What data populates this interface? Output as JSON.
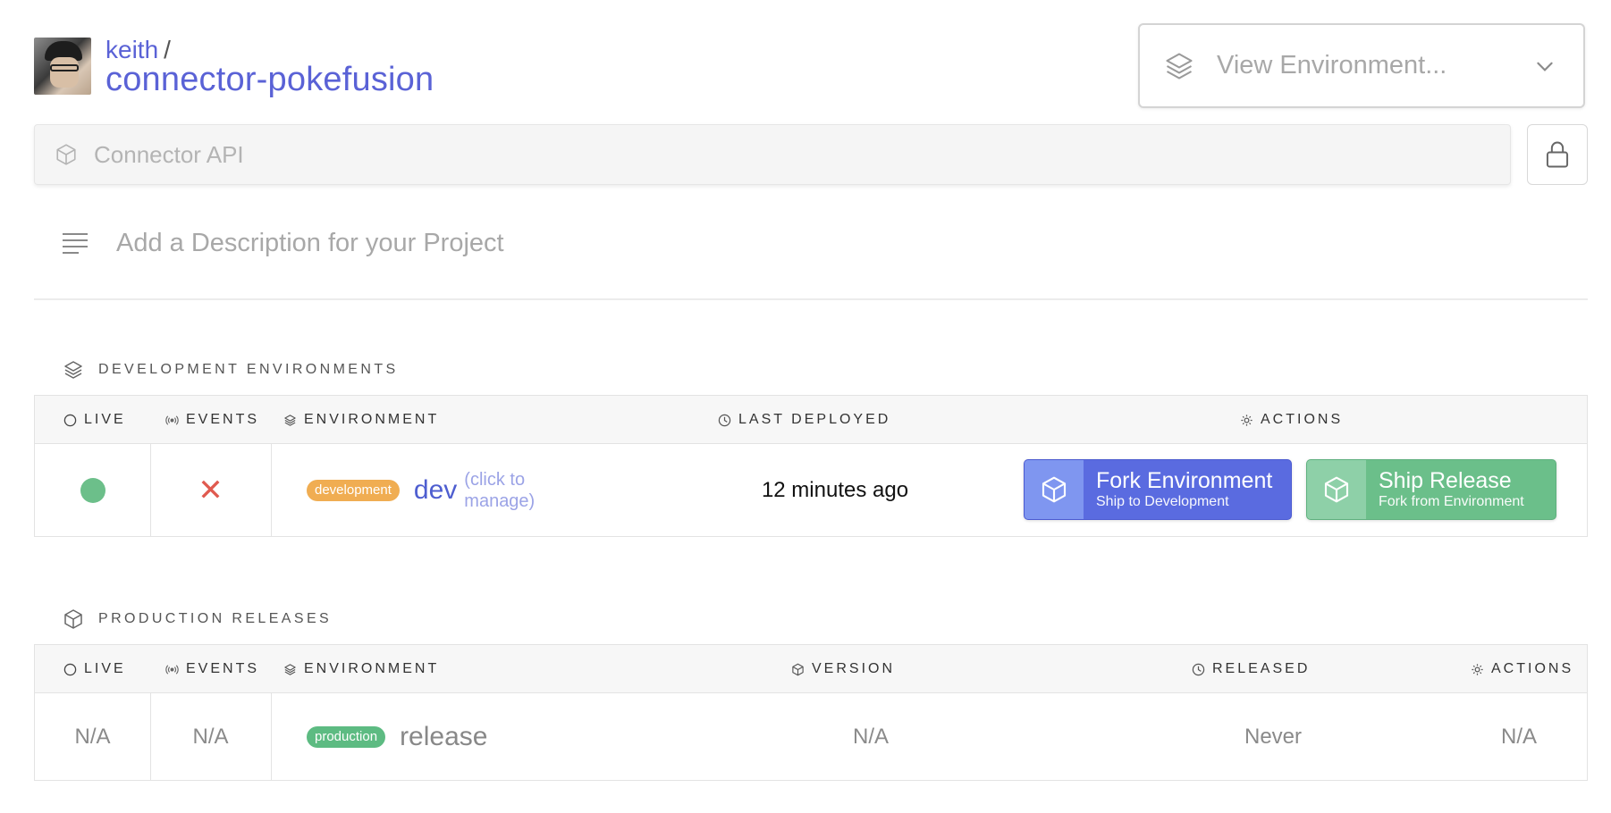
{
  "header": {
    "owner": "keith",
    "separator": "/",
    "project": "connector-pokefusion",
    "env_select_placeholder": "View Environment...",
    "api_placeholder": "Connector API",
    "description_placeholder": "Add a Description for your Project"
  },
  "dev_section": {
    "title": "DEVELOPMENT ENVIRONMENTS",
    "columns": {
      "live": "LIVE",
      "events": "EVENTS",
      "environment": "ENVIRONMENT",
      "last_deployed": "LAST DEPLOYED",
      "actions": "ACTIONS"
    },
    "row": {
      "live": true,
      "events": "✕",
      "badge": "development",
      "env": "dev",
      "hint": "(click to manage)",
      "last_deployed": "12 minutes ago",
      "fork_title": "Fork Environment",
      "fork_sub": "Ship to Development",
      "ship_title": "Ship Release",
      "ship_sub": "Fork from Environment"
    }
  },
  "prod_section": {
    "title": "PRODUCTION RELEASES",
    "columns": {
      "live": "LIVE",
      "events": "EVENTS",
      "environment": "ENVIRONMENT",
      "version": "VERSION",
      "released": "RELEASED",
      "actions": "ACTIONS"
    },
    "row": {
      "live": "N/A",
      "events": "N/A",
      "badge": "production",
      "env": "release",
      "version": "N/A",
      "released": "Never",
      "actions": "N/A"
    }
  },
  "colors": {
    "accent": "#5a62d6",
    "live_green": "#6cbf8a",
    "error_red": "#e05a4f",
    "dev_badge": "#f0ad52",
    "prod_badge": "#5dbb82",
    "fork_button": "#5a6be0",
    "ship_button": "#6bbf8a"
  },
  "icons": {
    "env_select": "layers-icon",
    "api": "cube-icon",
    "lock": "lock-icon",
    "description": "text-lines-icon",
    "dev_section": "layers-icon",
    "prod_section": "cube-icon",
    "live": "circle-icon",
    "events": "broadcast-icon",
    "environment": "layers-icon",
    "clock": "clock-icon",
    "actions": "gear-icon",
    "version": "cube-icon"
  }
}
